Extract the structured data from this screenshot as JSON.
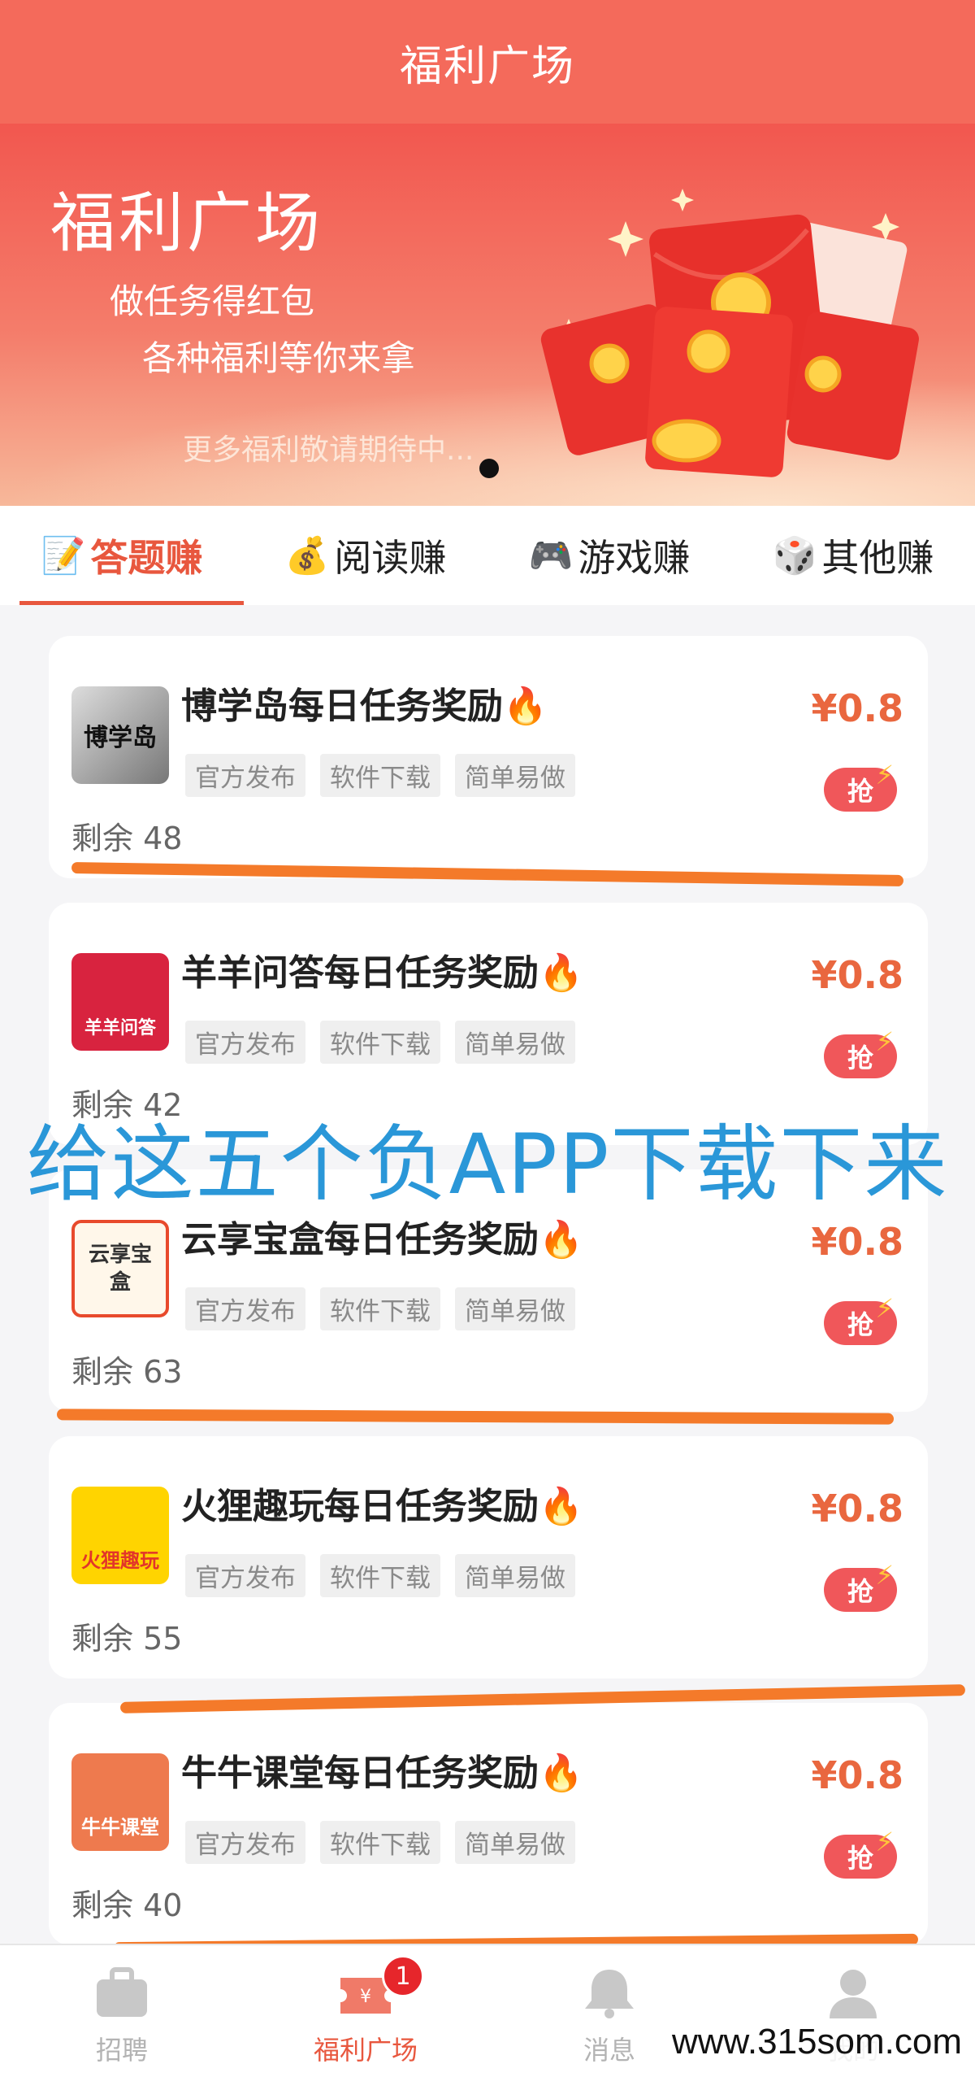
{
  "header": {
    "title": "福利广场"
  },
  "banner": {
    "title": "福利广场",
    "subtitle1": "做任务得红包",
    "subtitle2": "各种福利等你来拿",
    "more": "更多福利敬请期待中..."
  },
  "tabs": [
    {
      "icon": "📝",
      "label": "答题赚",
      "active": true
    },
    {
      "icon": "💰",
      "label": "阅读赚",
      "active": false
    },
    {
      "icon": "🎮",
      "label": "游戏赚",
      "active": false
    },
    {
      "icon": "🎲",
      "label": "其他赚",
      "active": false
    }
  ],
  "tasks": [
    {
      "title": "博学岛每日任务奖励🔥",
      "logo_text": "博学岛",
      "tags": [
        "官方发布",
        "软件下载",
        "简单易做"
      ],
      "remain": "剩余 48",
      "price": "¥0.8",
      "grab": "抢"
    },
    {
      "title": "羊羊问答每日任务奖励🔥",
      "logo_text": "羊羊问答",
      "tags": [
        "官方发布",
        "软件下载",
        "简单易做"
      ],
      "remain": "剩余 42",
      "price": "¥0.8",
      "grab": "抢"
    },
    {
      "title": "云享宝盒每日任务奖励🔥",
      "logo_text": "云享宝盒",
      "tags": [
        "官方发布",
        "软件下载",
        "简单易做"
      ],
      "remain": "剩余 63",
      "price": "¥0.8",
      "grab": "抢"
    },
    {
      "title": "火狸趣玩每日任务奖励🔥",
      "logo_text": "火狸趣玩",
      "tags": [
        "官方发布",
        "软件下载",
        "简单易做"
      ],
      "remain": "剩余 55",
      "price": "¥0.8",
      "grab": "抢"
    },
    {
      "title": "牛牛课堂每日任务奖励🔥",
      "logo_text": "牛牛课堂",
      "tags": [
        "官方发布",
        "软件下载",
        "简单易做"
      ],
      "remain": "剩余 40",
      "price": "¥0.8",
      "grab": "抢"
    }
  ],
  "overlay_text": "给这五个负APP下载下来",
  "bottom_nav": [
    {
      "label": "招聘",
      "icon": "briefcase-icon"
    },
    {
      "label": "福利广场",
      "icon": "ticket-icon",
      "badge": "1",
      "active": true
    },
    {
      "label": "消息",
      "icon": "bell-icon"
    },
    {
      "label": "我的",
      "icon": "user-icon"
    }
  ],
  "watermark": "www.315som.com"
}
